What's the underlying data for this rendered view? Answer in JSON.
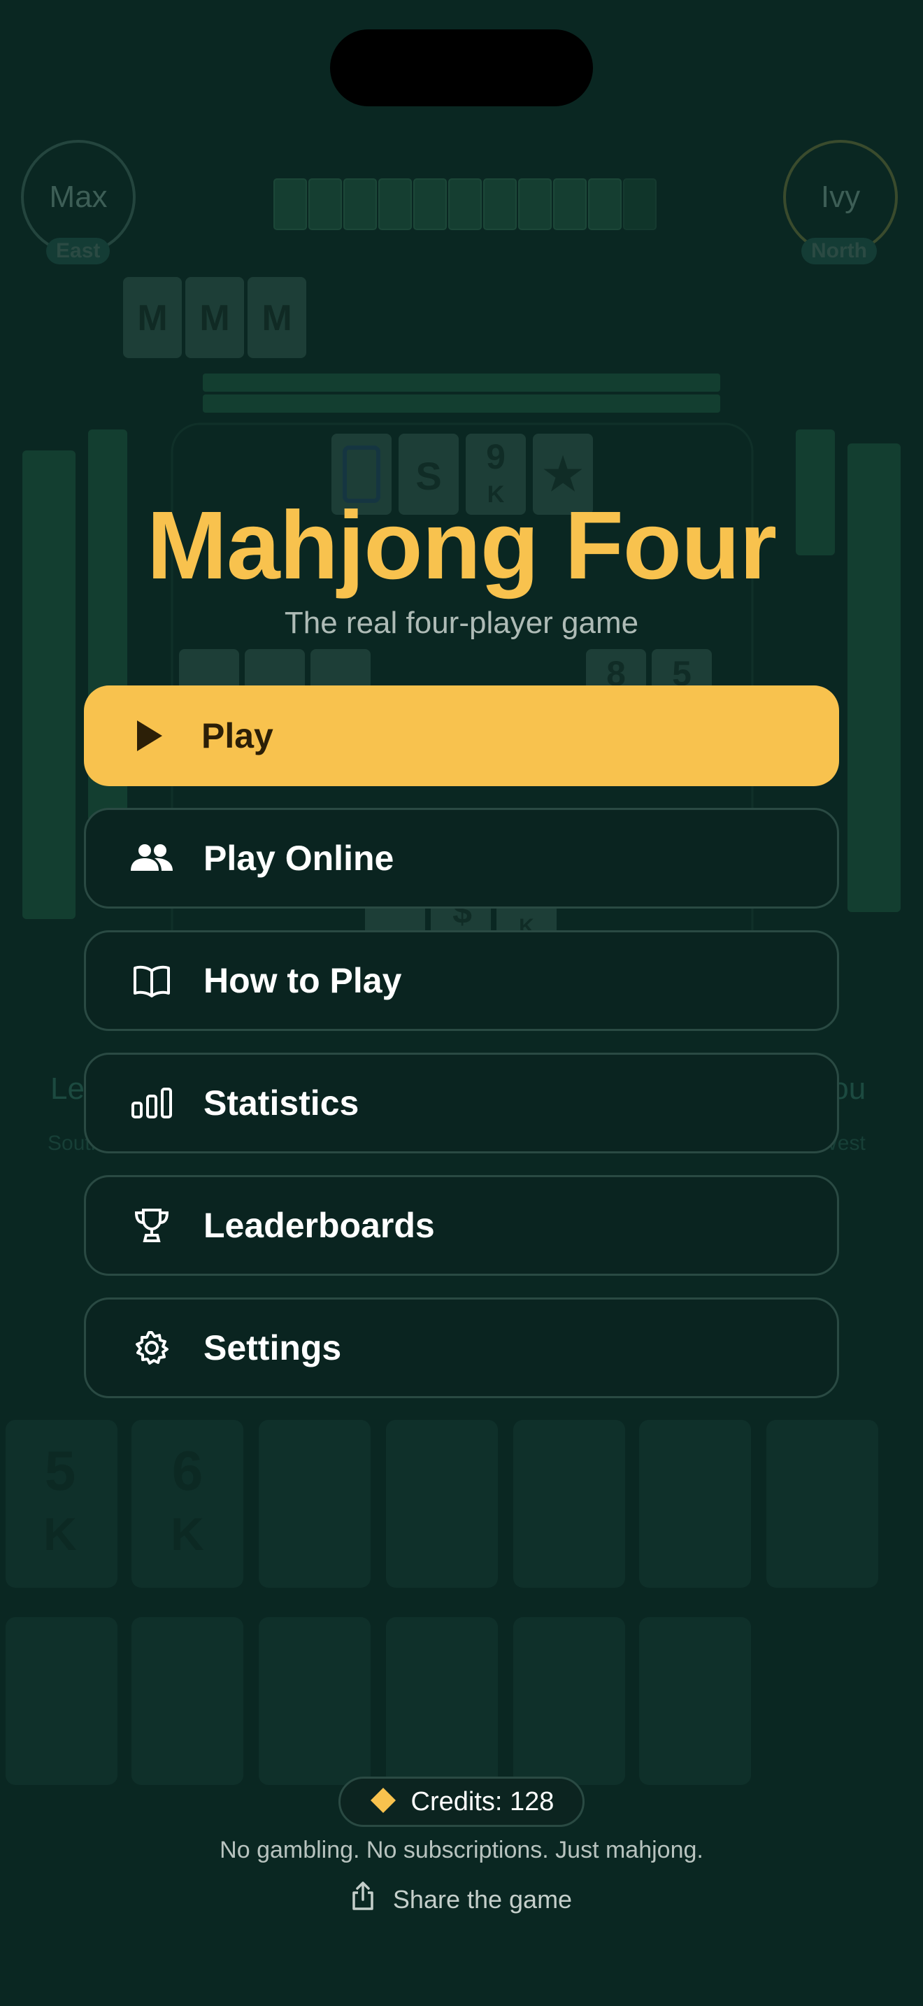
{
  "players": {
    "top_left": {
      "name": "Max",
      "seat": "East"
    },
    "top_right": {
      "name": "Ivy",
      "seat": "North"
    },
    "bottom_left": {
      "name": "Leo",
      "seat": "South"
    },
    "bottom_right": {
      "name": "You",
      "seat": "West"
    }
  },
  "app": {
    "title": "Mahjong Four",
    "subtitle": "The real four-player game"
  },
  "menu": {
    "play": {
      "label": "Play",
      "icon": "play-icon"
    },
    "play_online": {
      "label": "Play Online",
      "icon": "people-icon"
    },
    "how_to_play": {
      "label": "How to Play",
      "icon": "book-icon"
    },
    "statistics": {
      "label": "Statistics",
      "icon": "bar-chart-icon"
    },
    "leaderboards": {
      "label": "Leaderboards",
      "icon": "trophy-icon"
    },
    "settings": {
      "label": "Settings",
      "icon": "gear-icon"
    }
  },
  "footer": {
    "credits_label": "Credits: 128",
    "tagline": "No gambling. No subscriptions. Just mahjong.",
    "share_label": "Share the game"
  },
  "colors": {
    "background": "#0c302a",
    "accent": "#f8c24e",
    "button_dark": "#0a2420"
  }
}
